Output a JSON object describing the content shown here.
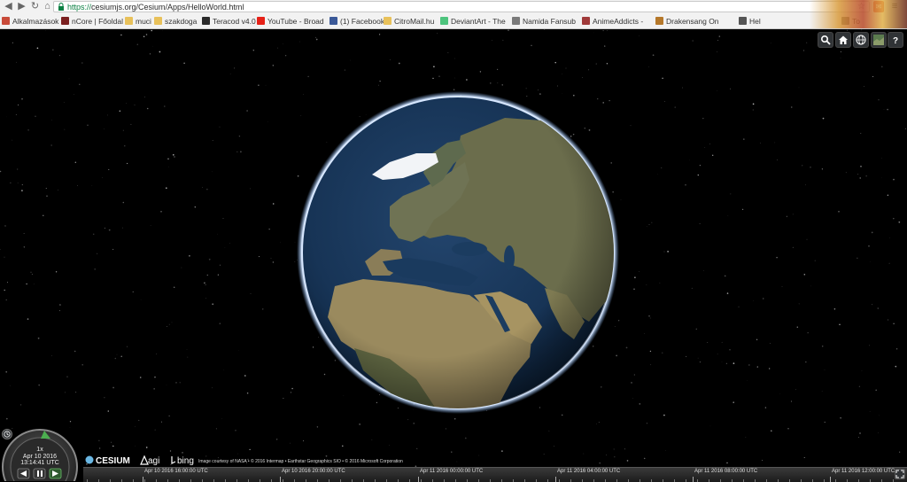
{
  "browser": {
    "url_scheme": "https://",
    "url_rest": "cesiumjs.org/Cesium/Apps/HelloWorld.html",
    "bookmarks": [
      {
        "label": "Alkalmazások",
        "color": "#c94b3a"
      },
      {
        "label": "nCore | Főoldal",
        "color": "#7a1f1f"
      },
      {
        "label": "muci",
        "color": "#e8c15a"
      },
      {
        "label": "szakdoga",
        "color": "#e8c15a"
      },
      {
        "label": "Teracod v4.0",
        "color": "#2b2b2b"
      },
      {
        "label": "YouTube - Broad",
        "color": "#e62117"
      },
      {
        "label": "(1) Facebook",
        "color": "#3b5998"
      },
      {
        "label": "CitroMail.hu",
        "color": "#e8c15a"
      },
      {
        "label": "DeviantArt - The",
        "color": "#4dc47d"
      },
      {
        "label": "Namida Fansub",
        "color": "#7a7a7a"
      },
      {
        "label": "AnimeAddicts -",
        "color": "#a03a3a"
      },
      {
        "label": "Drakensang On",
        "color": "#b5782a"
      },
      {
        "label": "Hel",
        "color": "#555555"
      },
      {
        "label": "To",
        "color": "#555555"
      }
    ]
  },
  "cesium": {
    "toolbar": {
      "search_icon": "search-icon",
      "home_icon": "home-icon",
      "globe_icon": "scene-mode-globe-icon",
      "layer_icon": "base-layer-picker-icon",
      "help_icon": "navigation-help-icon"
    },
    "clock": {
      "speed": "1x",
      "date": "Apr 10 2016",
      "time": "13:14:41 UTC"
    },
    "logos": {
      "cesium": "CESIUM",
      "agi": "agi",
      "bing": "bing"
    },
    "credits": "Image courtesy of NASA • © 2016 Intermap • Earthstar Geographics SIO • © 2016 Microsoft Corporation",
    "timeline": [
      {
        "label": "Apr 10 2016 16:00:00 UTC"
      },
      {
        "label": "Apr 10 2016 20:00:00 UTC"
      },
      {
        "label": "Apr 11 2016 00:00:00 UTC"
      },
      {
        "label": "Apr 11 2016 04:00:00 UTC"
      },
      {
        "label": "Apr 11 2016 08:00:00 UTC"
      },
      {
        "label": "Apr 11 2016 12:00:00 UTC"
      }
    ]
  }
}
